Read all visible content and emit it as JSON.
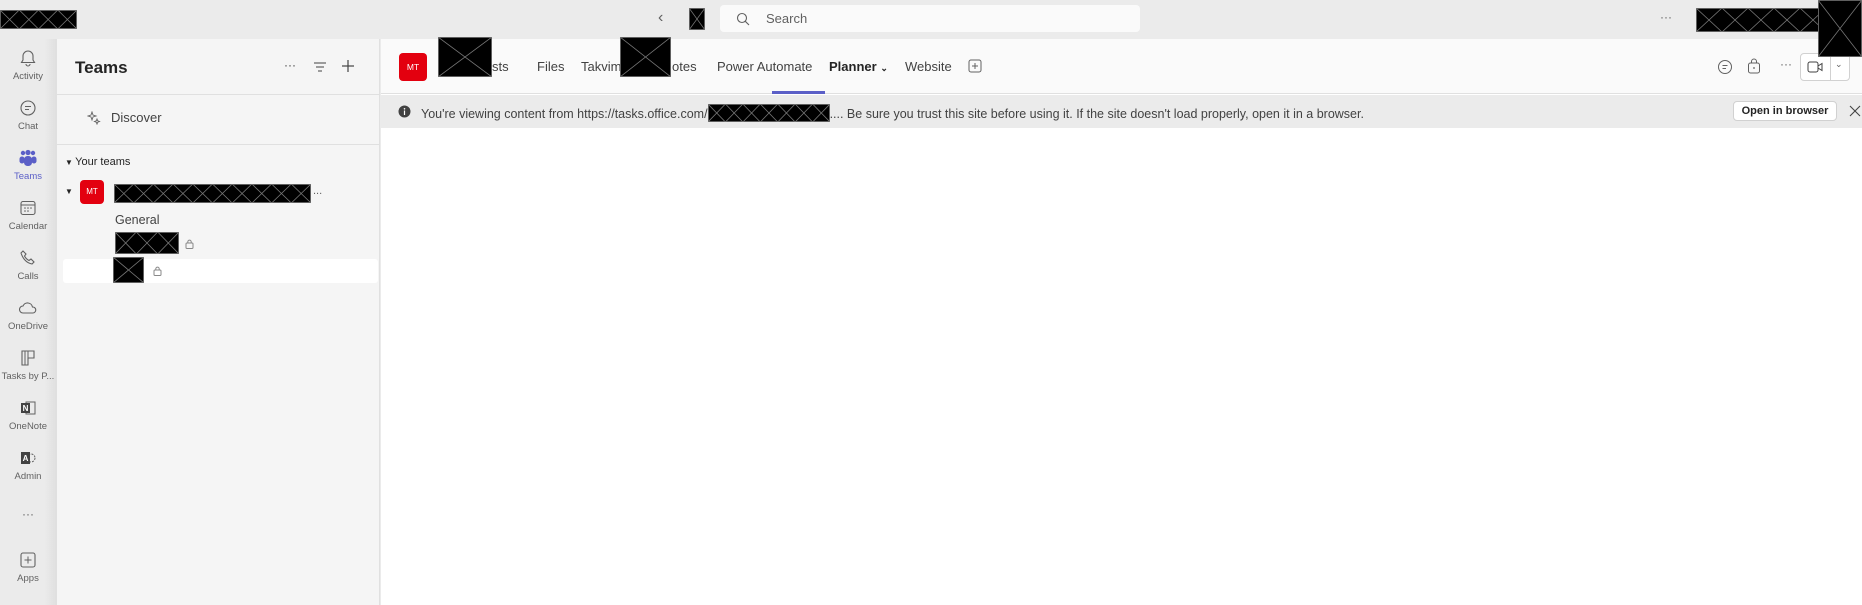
{
  "topbar": {
    "search_placeholder": "Search",
    "more": "···"
  },
  "rail": {
    "items": [
      {
        "label": "Activity"
      },
      {
        "label": "Chat"
      },
      {
        "label": "Teams"
      },
      {
        "label": "Calendar"
      },
      {
        "label": "Calls"
      },
      {
        "label": "OneDrive"
      },
      {
        "label": "Tasks by P..."
      },
      {
        "label": "OneNote"
      },
      {
        "label": "Admin"
      },
      {
        "label": "Apps"
      }
    ],
    "more": "···"
  },
  "panel": {
    "title": "Teams",
    "more": "···",
    "discover": "Discover",
    "your_teams": "Your teams",
    "team": {
      "initials": "MT",
      "ellipsis": "..."
    },
    "channels": [
      {
        "label": "General"
      }
    ]
  },
  "main": {
    "team_initials": "MT",
    "tabs": [
      {
        "label": "sts"
      },
      {
        "label": "Files"
      },
      {
        "label": "Takvim"
      },
      {
        "label": "otes"
      },
      {
        "label": "Power Automate"
      },
      {
        "label": "Planner",
        "active": true
      },
      {
        "label": "Website"
      }
    ],
    "more": "···",
    "banner": {
      "text_before": "You're viewing content from https://tasks.office.com/",
      "text_after": ".... Be sure you trust this site before using it. If the site doesn't load properly, open it in a browser.",
      "open_button": "Open in browser"
    }
  },
  "colors": {
    "accent": "#5b5fc7",
    "team_avatar": "#e3000f"
  }
}
